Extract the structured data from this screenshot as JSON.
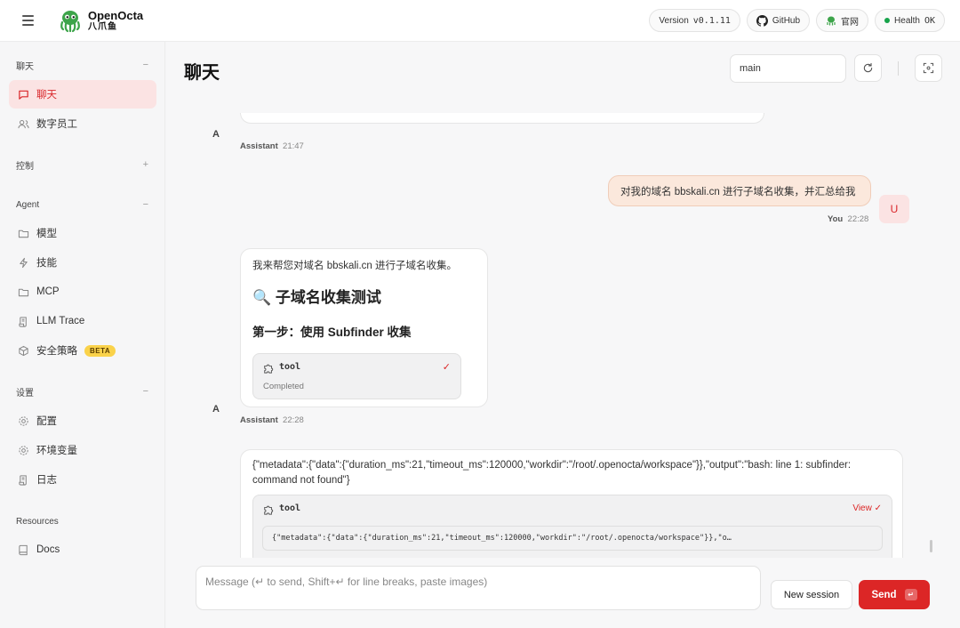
{
  "topbar": {
    "app_name": "OpenOcta",
    "app_subtitle": "八爪鱼",
    "version_label": "Version",
    "version_value": "v0.1.11",
    "github_label": "GitHub",
    "website_label": "官网",
    "health_label": "Health",
    "health_value": "OK",
    "health_color": "#16a34a"
  },
  "sidebar": {
    "sections": [
      {
        "title": "聊天",
        "toggle": "−"
      },
      {
        "title": "控制",
        "toggle": "+"
      },
      {
        "title": "Agent",
        "toggle": "−"
      },
      {
        "title": "设置",
        "toggle": "−"
      },
      {
        "title": "Resources",
        "toggle": ""
      }
    ],
    "items": {
      "chat": "聊天",
      "digital_staff": "数字员工",
      "models": "模型",
      "skills": "技能",
      "mcp": "MCP",
      "llm_trace": "LLM Trace",
      "security_policy": "安全策略",
      "beta_badge": "BETA",
      "config": "配置",
      "env_vars": "环境变量",
      "logs": "日志",
      "docs": "Docs"
    }
  },
  "main": {
    "title": "聊天",
    "session_value": "main",
    "accent_color": "#dc2626"
  },
  "messages": {
    "assistant_avatar": "A",
    "user_avatar": "U",
    "m1_role": "Assistant",
    "m1_time": "21:47",
    "user_text": "对我的域名 bbskali.cn 进行子域名收集，并汇总给我",
    "user_role": "You",
    "user_time": "22:28",
    "m2_intro": "我来帮您对域名 bbskali.cn 进行子域名收集。",
    "m2_heading": "🔍 子域名收集测试",
    "m2_subheading": "第一步：使用 Subfinder 收集",
    "m2_tool_label": "tool",
    "m2_tool_status": "Completed",
    "m2_role": "Assistant",
    "m2_time": "22:28",
    "m3_text": "{\"metadata\":{\"data\":{\"duration_ms\":21,\"timeout_ms\":120000,\"workdir\":\"/root/.openocta/workspace\"}},\"output\":\"bash: line 1: subfinder: command not found\"}",
    "m3_tool_label": "tool",
    "m3_view_label": "View ✓",
    "m3_tool_preview": "{\"metadata\":{\"data\":{\"duration_ms\":21,\"timeout_ms\":120000,\"workdir\":\"/root/.openocta/workspace\"}},\"o…"
  },
  "composer": {
    "placeholder": "Message (↵ to send, Shift+↵ for line breaks, paste images)",
    "new_session_label": "New session",
    "send_label": "Send",
    "send_kbd": "↵"
  }
}
